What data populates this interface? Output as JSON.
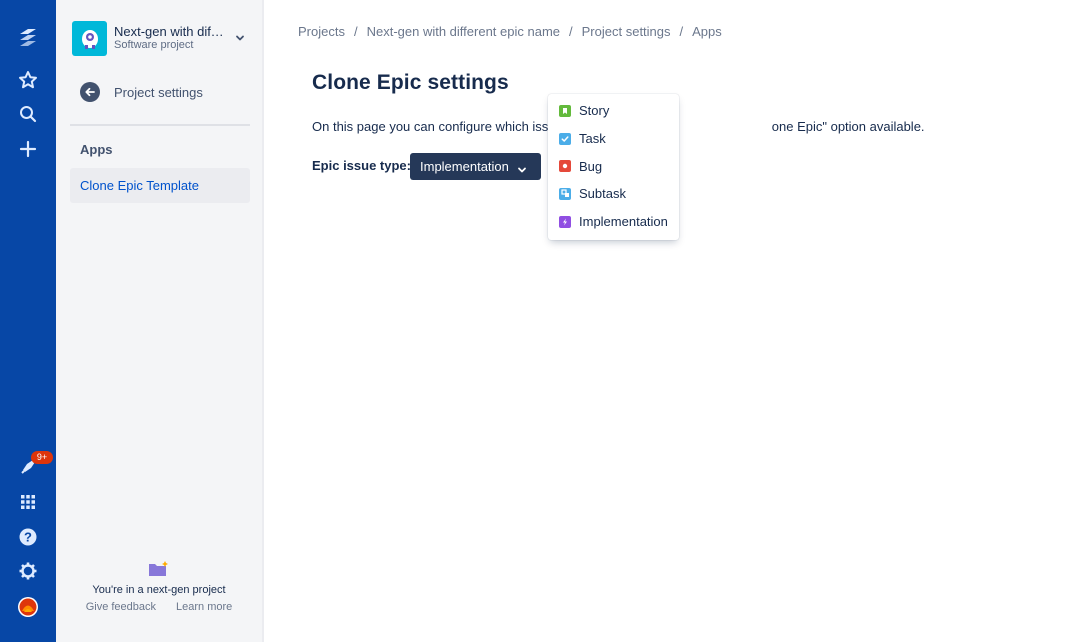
{
  "sidebar": {
    "project_name": "Next-gen with different epic name",
    "project_type": "Software project",
    "back_label": "Project settings",
    "section_heading": "Apps",
    "active_item": "Clone Epic Template",
    "footer_text": "You're in a next-gen project",
    "footer_links": [
      "Give feedback",
      "Learn more"
    ]
  },
  "global_nav": {
    "notification_count": "9+",
    "icons": [
      "jira-logo-icon",
      "star-icon",
      "search-icon",
      "plus-icon",
      "notifications-icon",
      "app-switcher-icon",
      "help-icon",
      "settings-icon",
      "user-avatar-icon"
    ]
  },
  "breadcrumbs": [
    "Projects",
    "Next-gen with different epic name",
    "Project settings",
    "Apps"
  ],
  "main": {
    "title": "Clone Epic settings",
    "description_left": "On this page you can configure which issue",
    "description_right": "one Epic\" option available.",
    "epic_label": "Epic issue type:",
    "epic_value": "Implementation"
  },
  "dropdown": {
    "options": [
      {
        "label": "Story",
        "icon": "story-icon",
        "color": "#63ba3c"
      },
      {
        "label": "Task",
        "icon": "task-icon",
        "color": "#4bade8"
      },
      {
        "label": "Bug",
        "icon": "bug-icon",
        "color": "#e5493a"
      },
      {
        "label": "Subtask",
        "icon": "subtask-icon",
        "color": "#4bade8"
      },
      {
        "label": "Implementation",
        "icon": "implementation-icon",
        "color": "#904ee2"
      }
    ]
  },
  "colors": {
    "global_nav": "#0747a6",
    "sidebar_bg": "#f4f5f7",
    "link_blue": "#0052cc",
    "select_bg": "#253858",
    "badge_red": "#de350b"
  }
}
